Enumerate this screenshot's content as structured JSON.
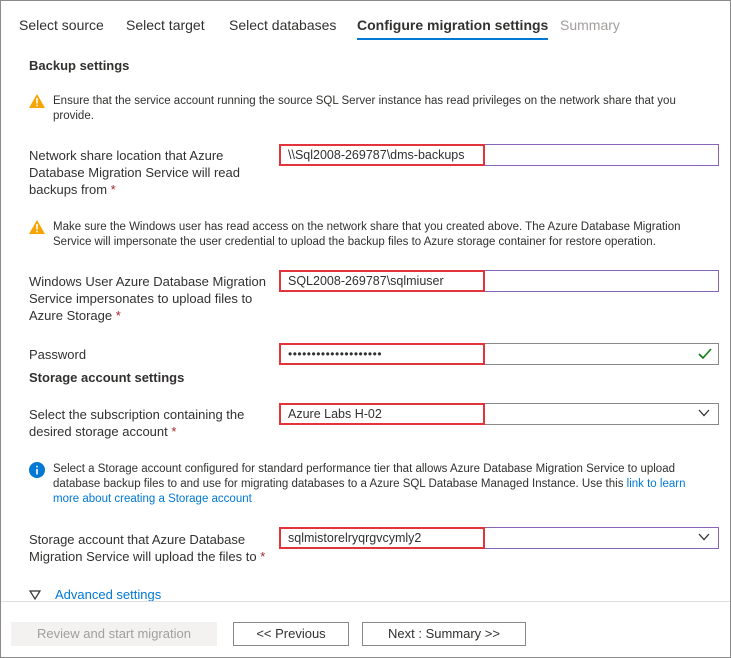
{
  "tabs": [
    {
      "label": "Select source"
    },
    {
      "label": "Select target"
    },
    {
      "label": "Select databases"
    },
    {
      "label": "Configure migration settings"
    },
    {
      "label": "Summary"
    }
  ],
  "backup": {
    "title": "Backup settings",
    "warning1": "Ensure that the service account running the source SQL Server instance has read privileges on the network share that you provide.",
    "share_label": "Network share location that Azure Database Migration Service will read backups from",
    "share_value": "\\\\Sql2008-269787\\dms-backups",
    "warning2": "Make sure the Windows user has read access on the network share that you created above. The Azure Database Migration Service will impersonate the user credential to upload the backup files to Azure storage container for restore operation.",
    "user_label": "Windows User Azure Database Migration Service impersonates to upload files to Azure Storage",
    "user_value": "SQL2008-269787\\sqlmiuser",
    "password_label": "Password",
    "password_value": "••••••••••••••••••••",
    "required_mark": "*"
  },
  "storage": {
    "title": "Storage account settings",
    "subscription_label": "Select the subscription containing the desired storage account",
    "subscription_value": "Azure Labs H-02",
    "info_text": "Select a Storage account configured for standard performance tier that allows Azure Database Migration Service to upload database backup files to and use for migrating databases to a Azure SQL Database Managed Instance. Use this",
    "info_link": "link to learn more about creating a Storage account",
    "account_label": "Storage account that Azure Database Migration Service will upload the files to",
    "account_value": "sqlmistorelryqrgvcymly2"
  },
  "advanced_label": "Advanced settings",
  "footer": {
    "review_label": "Review and start migration",
    "previous_label": "<< Previous",
    "next_label": "Next : Summary >>"
  },
  "colors": {
    "accent": "#0078d4",
    "highlight": "#e3343b",
    "warning": "#f7a400",
    "success": "#107c10"
  }
}
